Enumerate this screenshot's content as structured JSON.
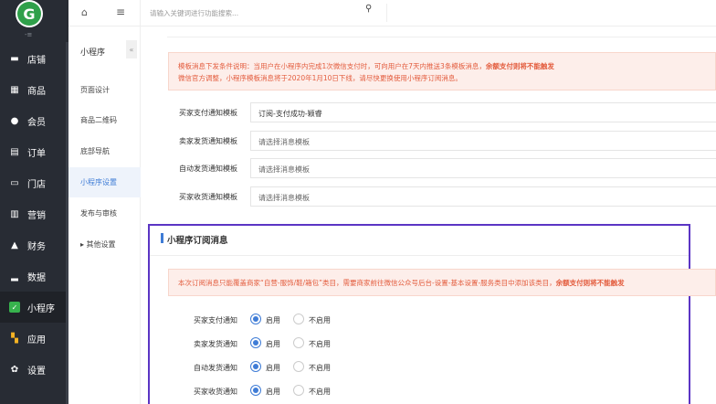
{
  "sidebar": {
    "logo_letter": "G",
    "collapse_mark": "-≡",
    "items": [
      {
        "label": "店铺",
        "icon": "store-icon"
      },
      {
        "label": "商品",
        "icon": "goods-icon"
      },
      {
        "label": "会员",
        "icon": "member-icon"
      },
      {
        "label": "订单",
        "icon": "order-icon"
      },
      {
        "label": "门店",
        "icon": "shop-icon"
      },
      {
        "label": "营销",
        "icon": "marketing-icon"
      },
      {
        "label": "财务",
        "icon": "finance-icon"
      },
      {
        "label": "数据",
        "icon": "data-icon"
      },
      {
        "label": "小程序",
        "icon": "miniprogram-icon"
      },
      {
        "label": "应用",
        "icon": "apps-icon"
      },
      {
        "label": "设置",
        "icon": "settings-icon"
      }
    ],
    "active_index": 8
  },
  "subnav": {
    "title": "小程序",
    "collapse": "«",
    "items": [
      {
        "label": "页面设计"
      },
      {
        "label": "商品二维码"
      },
      {
        "label": "底部导航"
      },
      {
        "label": "小程序设置"
      },
      {
        "label": "发布与审核"
      },
      {
        "label": "▸ 其他设置"
      }
    ],
    "active_index": 3
  },
  "topbar": {
    "search_placeholder": "请输入关键词进行功能搜索..."
  },
  "notice1": {
    "line1_prefix": "模板消息下发条件说明：当用户在小程序内完成1次微信支付时，可向用户在7天内推送3条模板消息，",
    "line1_bold": "余额支付则将不能触发",
    "line2": "微信官方调整，小程序模板消息将于2020年1月10日下线，请尽快更换使用小程序订阅消息。"
  },
  "template_rows": [
    {
      "label": "买家支付通知模板",
      "value": "订阅-支付成功-颖睿",
      "placeholder": false
    },
    {
      "label": "卖家发货通知模板",
      "value": "请选择消息模板",
      "placeholder": true
    },
    {
      "label": "自动发货通知模板",
      "value": "请选择消息模板",
      "placeholder": true
    },
    {
      "label": "买家收货通知模板",
      "value": "请选择消息模板",
      "placeholder": true
    }
  ],
  "subscribe": {
    "title": "小程序订阅消息",
    "notice_prefix": "本次订阅消息只能覆盖商家“自营-服饰/鞋/箱包”类目，需要商家前往微信公众号后台-设置-基本设置-服务类目中添加该类目，",
    "notice_bold": "余额支付则将不能触发",
    "enable_label": "启用",
    "disable_label": "不启用",
    "rows": [
      {
        "label": "买家支付通知",
        "enabled": true
      },
      {
        "label": "卖家发货通知",
        "enabled": true
      },
      {
        "label": "自动发货通知",
        "enabled": true
      },
      {
        "label": "买家收货通知",
        "enabled": true
      }
    ]
  },
  "colors": {
    "sidebar_bg": "#282c34",
    "accent": "#3f7cd6",
    "notice_text": "#e35c3d",
    "highlight_border": "#5b35c4"
  }
}
